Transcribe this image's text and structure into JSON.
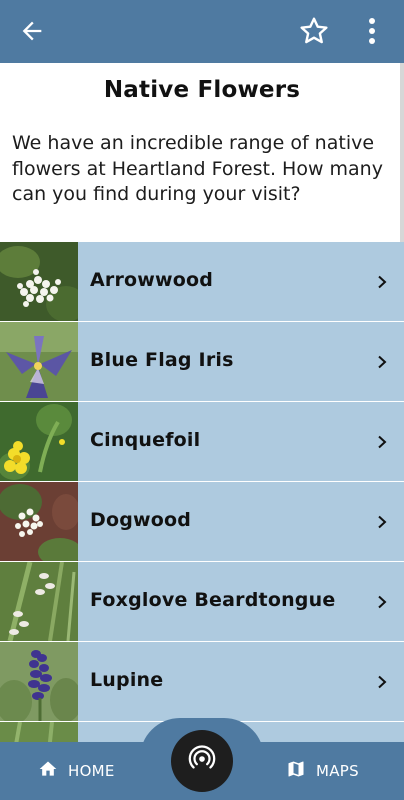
{
  "app_bar": {
    "back_icon": "arrow-left-icon",
    "favorite_icon": "star-outline-icon",
    "more_icon": "more-vertical-icon",
    "color": "#4f7aa1"
  },
  "page": {
    "title": "Native Flowers",
    "intro": "We have an incredible range of native flowers at Heartland Forest. How many can you find during your visit?"
  },
  "list": {
    "row_color": "#aecadf",
    "items": [
      {
        "label": "Arrowwood"
      },
      {
        "label": "Blue Flag Iris"
      },
      {
        "label": "Cinquefoil"
      },
      {
        "label": "Dogwood"
      },
      {
        "label": "Foxglove Beardtongue"
      },
      {
        "label": "Lupine"
      }
    ]
  },
  "bottom_nav": {
    "home_label": "HOME",
    "maps_label": "MAPS",
    "home_icon": "home-icon",
    "maps_icon": "map-icon",
    "center_icon": "beacon-icon"
  }
}
